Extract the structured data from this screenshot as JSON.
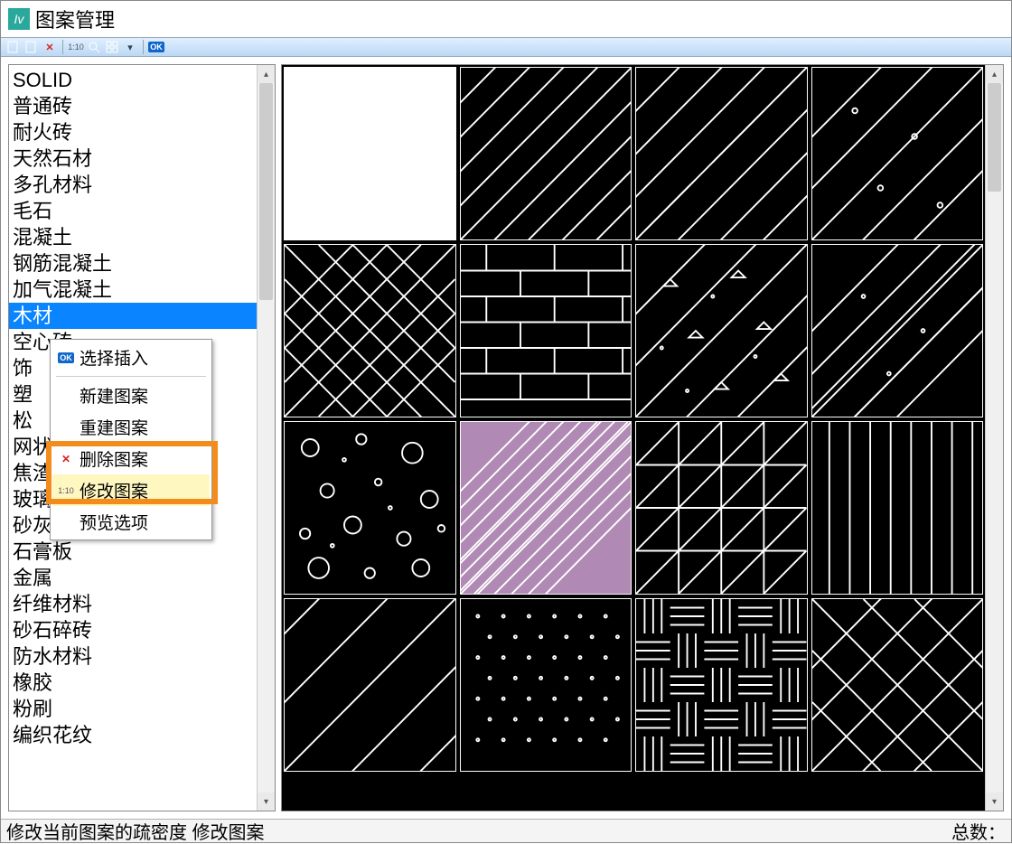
{
  "window": {
    "title": "图案管理"
  },
  "toolbar": {
    "density_label": "1:10"
  },
  "list": {
    "items": [
      "SOLID",
      "普通砖",
      "耐火砖",
      "天然石材",
      "多孔材料",
      "毛石",
      "混凝土",
      "钢筋混凝土",
      "加气混凝土",
      "木材",
      "空心砖",
      "饰",
      "塑",
      "松",
      "",
      "",
      "网状材料",
      "焦渣矿渣",
      "玻璃",
      "砂灰土",
      "石膏板",
      "金属",
      "纤维材料",
      "砂石碎砖",
      "防水材料",
      "橡胶",
      "粉刷",
      "编织花纹"
    ],
    "selected_index": 9
  },
  "context_menu": {
    "items": [
      {
        "label": "选择插入",
        "icon": "ok"
      },
      {
        "label": "新建图案",
        "icon": "new"
      },
      {
        "label": "重建图案",
        "icon": "rebuild"
      },
      {
        "label": "删除图案",
        "icon": "delete"
      },
      {
        "label": "修改图案",
        "icon": "edit"
      },
      {
        "label": "预览选项",
        "icon": "preview"
      }
    ],
    "highlighted_index": 4
  },
  "statusbar": {
    "left": "修改当前图案的疏密度  修改图案",
    "right": "总数："
  }
}
